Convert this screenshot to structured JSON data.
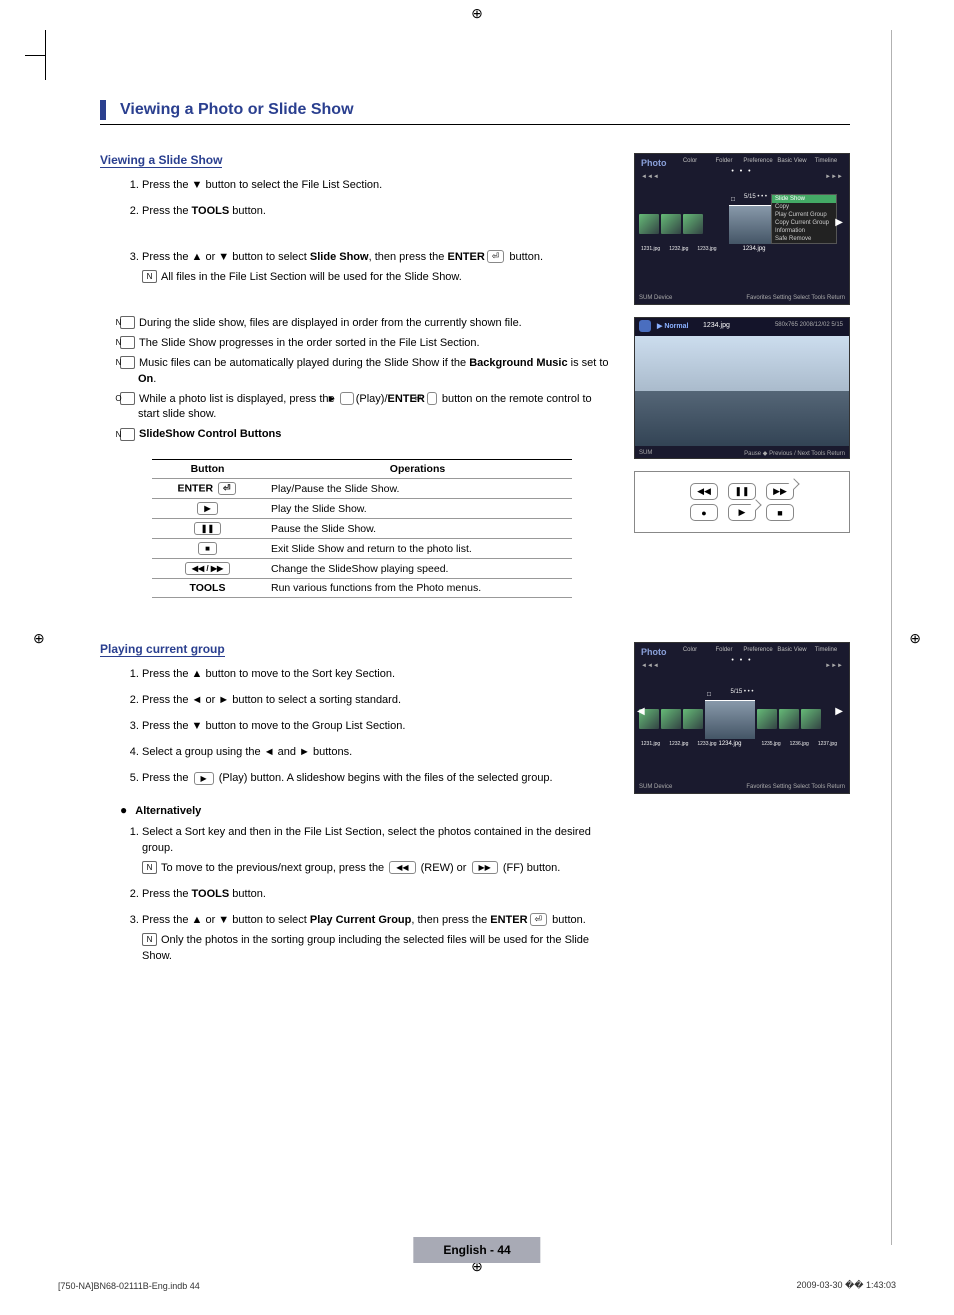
{
  "page_title": "Viewing a Photo or Slide Show",
  "section1": {
    "heading": "Viewing a Slide Show",
    "step1": "Press the ▼ button to select the File List Section.",
    "step2_a": "Press the ",
    "step2_b": "TOOLS",
    "step2_c": " button.",
    "step3_a": "Press the ▲ or ▼ button to select ",
    "step3_b": "Slide Show",
    "step3_c": ", then press the ",
    "step3_d": "ENTER",
    "step3_e": " button.",
    "step3_note": "All files in the File List Section will be used for the Slide Show.",
    "note1": "During the slide show, files are displayed in order from the currently shown file.",
    "note2": "The Slide Show progresses in the order sorted in the File List Section.",
    "note3_a": "Music files can be automatically played during the Slide Show if the ",
    "note3_b": "Background Music",
    "note3_c": " is set to ",
    "note3_d": "On",
    "note3_e": ".",
    "note4_a": "While a photo list is displayed, press the ",
    "note4_b": "(Play)/",
    "note4_c": "ENTER",
    "note4_d": " button on the remote control to start slide show.",
    "note5": "SlideShow Control Buttons"
  },
  "table": {
    "header_button": "Button",
    "header_ops": "Operations",
    "r1_btn": "ENTER",
    "r1_op": "Play/Pause the Slide Show.",
    "r2_btn": "▶",
    "r2_op": "Play the Slide Show.",
    "r3_btn": "❚❚",
    "r3_op": "Pause the Slide Show.",
    "r4_btn": "■",
    "r4_op": "Exit Slide Show and return to the photo list.",
    "r5_btn": "◀◀ / ▶▶",
    "r5_op": "Change the SlideShow playing speed.",
    "r6_btn": "TOOLS",
    "r6_op": "Run various functions from the Photo menus."
  },
  "section2": {
    "heading": "Playing current group",
    "step1": "Press the ▲ button to move to the Sort key Section.",
    "step2": "Press the ◄ or ► button to select a sorting standard.",
    "step3": "Press the ▼ button to move to the Group List Section.",
    "step4": "Select a group using the ◄ and ► buttons.",
    "step5_a": "Press the ",
    "step5_b": " (Play) button. A slideshow begins with the files of the selected group.",
    "alt_heading": "Alternatively",
    "alt1": "Select a Sort key and then in the File List Section, select the photos contained in the desired group.",
    "alt1_note_a": "To move to the previous/next group, press the ",
    "alt1_note_b": " (REW) or ",
    "alt1_note_c": " (FF) button.",
    "alt2_a": "Press the ",
    "alt2_b": "TOOLS",
    "alt2_c": " button.",
    "alt3_a": "Press the ▲ or ▼ button to select ",
    "alt3_b": "Play Current Group",
    "alt3_c": ", then press the ",
    "alt3_d": "ENTER",
    "alt3_e": " button.",
    "alt3_note": "Only the photos in the sorting group including the selected files will be used for the Slide Show."
  },
  "screenshot1": {
    "label": "Photo",
    "tabs": [
      "Color",
      "Folder",
      "Preference",
      "Basic View",
      "Timeline"
    ],
    "counter": "5/15",
    "main_thumb": "1234.jpg",
    "thumbs": [
      "1231.jpg",
      "1232.jpg",
      "1233.jpg"
    ],
    "arrow": "▶",
    "menu_active": "Slide Show",
    "menu_items": [
      "Copy",
      "Play Current Group",
      "Copy Current Group",
      "Information",
      "Safe Remove"
    ],
    "footer_left": "SUM     Device",
    "footer_right": "Favorites Setting   Select   Tools   Return",
    "ind_dots": "• • •"
  },
  "screenshot2": {
    "normal": "▶ Normal",
    "filename": "1234.jpg",
    "meta": "580x765     2008/12/02     5/15",
    "footer_left": "SUM",
    "footer_right": "Pause   ◆ Previous / Next    Tools    Return"
  },
  "remote": {
    "rew": "◀◀",
    "pause": "❚❚",
    "ff": "▶▶",
    "rec": "●",
    "play": "▶",
    "stop": "■"
  },
  "screenshot3": {
    "label": "Photo",
    "tabs": [
      "Color",
      "Folder",
      "Preference",
      "Basic View",
      "Timeline"
    ],
    "counter": "5/15",
    "main_thumb": "1234.jpg",
    "thumbs_left": [
      "1231.jpg",
      "1232.jpg",
      "1233.jpg"
    ],
    "thumbs_right": [
      "1235.jpg",
      "1236.jpg",
      "1237.jpg"
    ],
    "footer_left": "SUM     Device",
    "footer_right": "Favorites Setting   Select   Tools   Return",
    "ind_dots": "• • •"
  },
  "footer": {
    "pagelabel": "English - 44",
    "doc_left": "[750-NA]BN68-02111B-Eng.indb   44",
    "doc_right": "2009-03-30   �� 1:43:03"
  }
}
